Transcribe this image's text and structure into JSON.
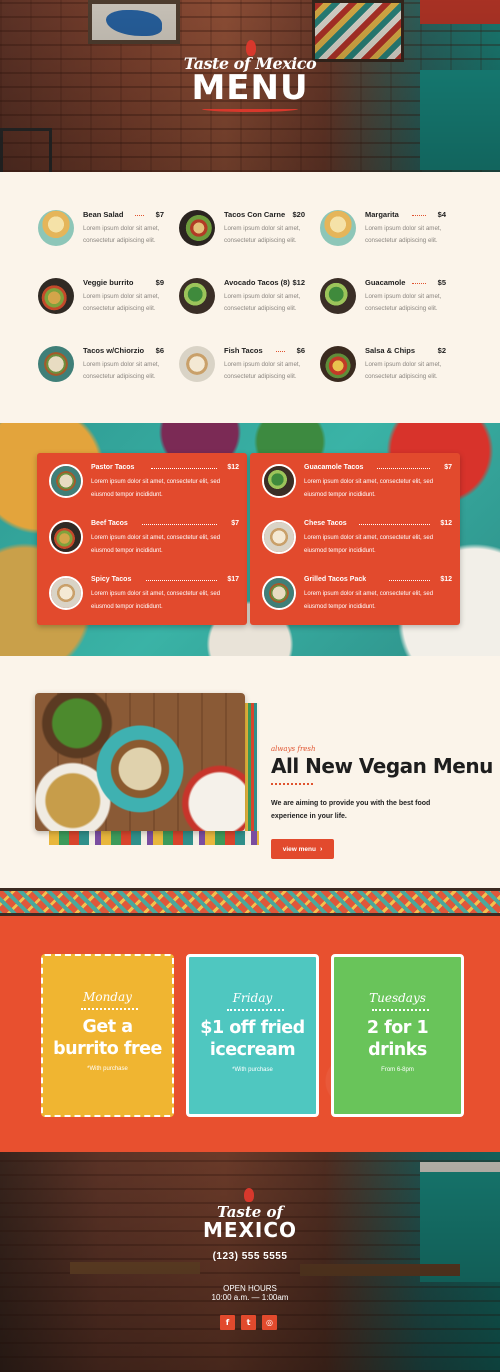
{
  "hero": {
    "logo_script": "Taste of Mexico",
    "logo_title": "MENU"
  },
  "menu": [
    {
      "name": "Bean Salad",
      "price": "$7",
      "desc": "Lorem ipsum dolor sit amet, consectetur adipiscing elit."
    },
    {
      "name": "Tacos Con Carne",
      "price": "$20",
      "desc": "Lorem ipsum dolor sit amet, consectetur adipiscing elit."
    },
    {
      "name": "Margarita",
      "price": "$4",
      "desc": "Lorem ipsum dolor sit amet, consectetur adipiscing elit."
    },
    {
      "name": "Veggie burrito",
      "price": "$9",
      "desc": "Lorem ipsum dolor sit amet, consectetur adipiscing elit."
    },
    {
      "name": "Avocado Tacos (8)",
      "price": "$12",
      "desc": "Lorem ipsum dolor sit amet, consectetur adipiscing elit."
    },
    {
      "name": "Guacamole",
      "price": "$5",
      "desc": "Lorem ipsum dolor sit amet, consectetur adipiscing elit."
    },
    {
      "name": "Tacos w/Chiorzio",
      "price": "$6",
      "desc": "Lorem ipsum dolor sit amet, consectetur adipiscing elit."
    },
    {
      "name": "Fish Tacos",
      "price": "$6",
      "desc": "Lorem ipsum dolor sit amet, consectetur adipiscing elit."
    },
    {
      "name": "Salsa & Chips",
      "price": "$2",
      "desc": "Lorem ipsum dolor sit amet, consectetur adipiscing elit."
    }
  ],
  "featured": {
    "left": [
      {
        "name": "Pastor Tacos",
        "price": "$12",
        "desc": "Lorem ipsum dolor sit amet, consectetur elit, sed eiusmod tempor incididunt."
      },
      {
        "name": "Beef Tacos",
        "price": "$7",
        "desc": "Lorem ipsum dolor sit amet, consectetur elit, sed eiusmod tempor incididunt."
      },
      {
        "name": "Spicy Tacos",
        "price": "$17",
        "desc": "Lorem ipsum dolor sit amet, consectetur elit, sed eiusmod tempor incididunt."
      }
    ],
    "right": [
      {
        "name": "Guacamole Tacos",
        "price": "$7",
        "desc": "Lorem ipsum dolor sit amet, consectetur elit, sed eiusmod tempor incididunt."
      },
      {
        "name": "Chese Tacos",
        "price": "$12",
        "desc": "Lorem ipsum dolor sit amet, consectetur elit, sed eiusmod tempor incididunt."
      },
      {
        "name": "Grilled Tacos Pack",
        "price": "$12",
        "desc": "Lorem ipsum dolor sit amet, consectetur elit, sed eiusmod tempor incididunt."
      }
    ]
  },
  "vegan": {
    "kicker": "always fresh",
    "title": "All New Vegan Menu",
    "text": "We are aiming to provide you with the best food experience in your life.",
    "button_label": "view menu"
  },
  "specials": [
    {
      "day": "Monday",
      "offer": "Get a burrito free",
      "note": "*With purchase",
      "color": "#f0b531"
    },
    {
      "day": "Friday",
      "offer": "$1 off fried icecream",
      "note": "*With purchase",
      "color": "#4fc7c0"
    },
    {
      "day": "Tuesdays",
      "offer": "2 for 1 drinks",
      "note": "From 6-8pm",
      "color": "#69c45a"
    }
  ],
  "footer": {
    "logo_script": "Taste of",
    "logo_title": "MEXICO",
    "phone": "(123) 555 5555",
    "hours_heading": "OPEN HOURS",
    "hours": "10:00 a.m. — 1:00am",
    "social": [
      {
        "icon": "facebook-icon",
        "glyph": "f"
      },
      {
        "icon": "twitter-icon",
        "glyph": "t"
      },
      {
        "icon": "instagram-icon",
        "glyph": "◎"
      }
    ]
  },
  "colors": {
    "accent": "#e24a2d",
    "cream": "#fbf4ea",
    "teal": "#2f9b93"
  }
}
